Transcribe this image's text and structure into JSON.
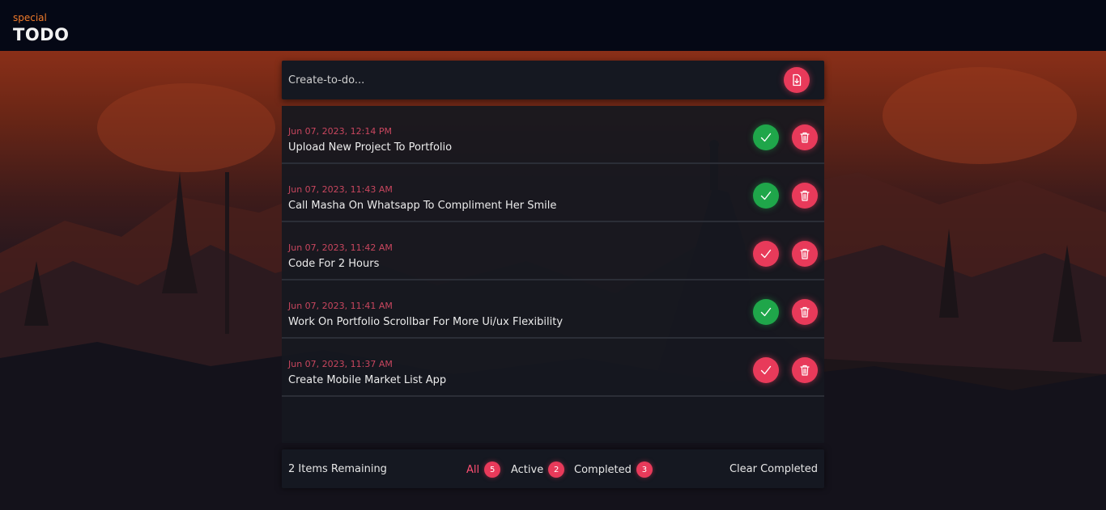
{
  "header": {
    "brand_small": "special",
    "brand_title": "TODO"
  },
  "create": {
    "placeholder": "Create-to-do...",
    "value": ""
  },
  "todos": [
    {
      "date": "Jun 07, 2023, 12:14 PM",
      "text": "Upload New Project To Portfolio",
      "completed": true
    },
    {
      "date": "Jun 07, 2023, 11:43 AM",
      "text": "Call Masha On Whatsapp To Compliment Her Smile",
      "completed": true
    },
    {
      "date": "Jun 07, 2023, 11:42 AM",
      "text": "Code For 2 Hours",
      "completed": false
    },
    {
      "date": "Jun 07, 2023, 11:41 AM",
      "text": "Work On Portfolio Scrollbar For More Ui/ux Flexibility",
      "completed": true
    },
    {
      "date": "Jun 07, 2023, 11:37 AM",
      "text": "Create Mobile Market List App",
      "completed": false
    }
  ],
  "footer": {
    "remaining": "2 Items Remaining",
    "filters": [
      {
        "label": "All",
        "count": "5",
        "selected": true
      },
      {
        "label": "Active",
        "count": "2",
        "selected": false
      },
      {
        "label": "Completed",
        "count": "3",
        "selected": false
      }
    ],
    "clear_label": "Clear Completed"
  },
  "colors": {
    "accent": "#e83a5a",
    "done_green": "#1fa64a",
    "brand_orange": "#f07a2a",
    "panel_bg": "#151821",
    "topbar_bg": "#050815"
  },
  "icons": {
    "create": "file-download-icon",
    "check": "check-icon",
    "delete": "trash-icon"
  }
}
